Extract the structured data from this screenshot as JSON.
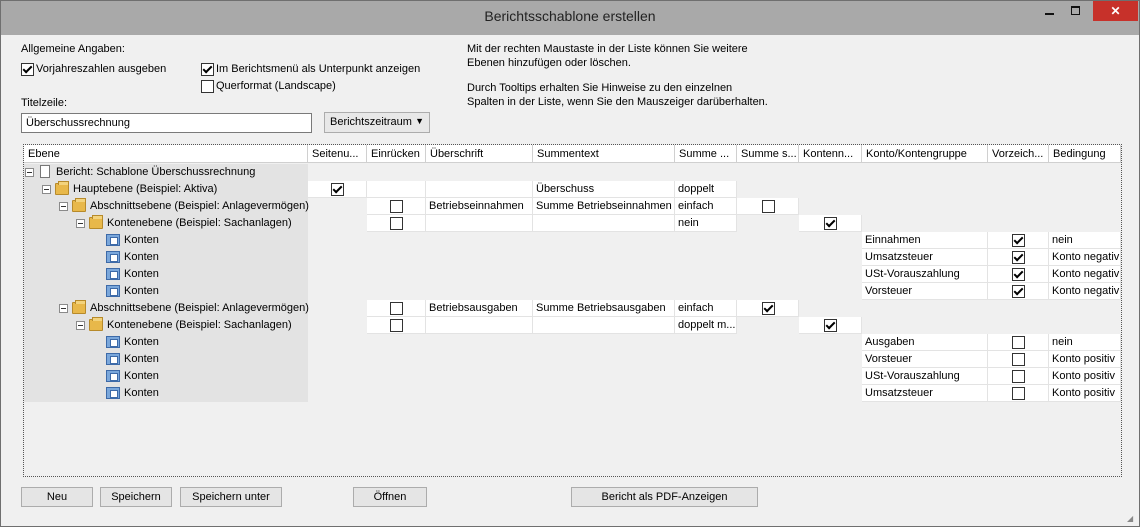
{
  "window": {
    "title": "Berichtsschablone erstellen"
  },
  "general": {
    "heading": "Allgemeine Angaben:",
    "prev_year": {
      "label": "Vorjahreszahlen ausgeben",
      "checked": true
    },
    "submenu": {
      "label": "Im Berichtsmenü als Unterpunkt anzeigen",
      "checked": true
    },
    "landscape": {
      "label": "Querformat (Landscape)",
      "checked": false
    },
    "title_label": "Titelzeile:",
    "title_value": "Überschussrechnung",
    "period_value": "Berichtszeitraum"
  },
  "hints": {
    "line1": "Mit der rechten Maustaste in der Liste können Sie weitere",
    "line2": "Ebenen hinzufügen oder löschen.",
    "line3": "Durch Tooltips erhalten Sie Hinweise zu den einzelnen",
    "line4": "Spalten in der Liste, wenn Sie den Mauszeiger darüberhalten."
  },
  "columns": [
    "Ebene",
    "Seitenu...",
    "Einrücken",
    "Überschrift",
    "Summentext",
    "Summe ...",
    "Summe s...",
    "Kontenn...",
    "Konto/Kontengruppe",
    "Vorzeich...",
    "Bedingung"
  ],
  "rows": [
    {
      "level": 0,
      "icon": "doc",
      "expand": true,
      "text": "Bericht: Schablone Überschussrechnung",
      "cells": {}
    },
    {
      "level": 1,
      "icon": "folder",
      "expand": true,
      "text": "Hauptebene (Beispiel: Aktiva)",
      "cells": {
        "seiten": true,
        "einr": null,
        "ueber": "",
        "summentext": "Überschuss",
        "summe": "doppelt"
      }
    },
    {
      "level": 2,
      "icon": "folder",
      "expand": true,
      "text": "Abschnittsebene (Beispiel: Anlagevermögen)",
      "cells": {
        "einr": false,
        "ueber": "Betriebseinnahmen",
        "summentext": "Summe Betriebseinnahmen",
        "summe": "einfach",
        "summes": false
      }
    },
    {
      "level": 3,
      "icon": "folder",
      "expand": true,
      "text": "Kontenebene (Beispiel: Sachanlagen)",
      "cells": {
        "einr": false,
        "ueber": "",
        "summentext": "",
        "summe": "nein",
        "konten": true
      }
    },
    {
      "level": 4,
      "icon": "acc",
      "expand": false,
      "text": "Konten",
      "cells": {
        "konto": "Einnahmen",
        "vorz": true,
        "bed": "nein"
      }
    },
    {
      "level": 4,
      "icon": "acc",
      "expand": false,
      "text": "Konten",
      "cells": {
        "konto": "Umsatzsteuer",
        "vorz": true,
        "bed": "Konto negativ"
      }
    },
    {
      "level": 4,
      "icon": "acc",
      "expand": false,
      "text": "Konten",
      "cells": {
        "konto": "USt-Vorauszahlung",
        "vorz": true,
        "bed": "Konto negativ"
      }
    },
    {
      "level": 4,
      "icon": "acc",
      "expand": false,
      "text": "Konten",
      "cells": {
        "konto": "Vorsteuer",
        "vorz": true,
        "bed": "Konto negativ"
      }
    },
    {
      "level": 2,
      "icon": "folder",
      "expand": true,
      "text": "Abschnittsebene (Beispiel: Anlagevermögen)",
      "cells": {
        "einr": false,
        "ueber": "Betriebsausgaben",
        "summentext": "Summe Betriebsausgaben",
        "summe": "einfach",
        "summes": true
      }
    },
    {
      "level": 3,
      "icon": "folder",
      "expand": true,
      "text": "Kontenebene (Beispiel: Sachanlagen)",
      "cells": {
        "einr": false,
        "ueber": "",
        "summentext": "",
        "summe": "doppelt m...",
        "konten": true
      }
    },
    {
      "level": 4,
      "icon": "acc",
      "expand": false,
      "text": "Konten",
      "cells": {
        "konto": "Ausgaben",
        "vorz": false,
        "bed": "nein"
      }
    },
    {
      "level": 4,
      "icon": "acc",
      "expand": false,
      "text": "Konten",
      "cells": {
        "konto": "Vorsteuer",
        "vorz": false,
        "bed": "Konto positiv"
      }
    },
    {
      "level": 4,
      "icon": "acc",
      "expand": false,
      "text": "Konten",
      "cells": {
        "konto": "USt-Vorauszahlung",
        "vorz": false,
        "bed": "Konto positiv"
      }
    },
    {
      "level": 4,
      "icon": "acc",
      "expand": false,
      "text": "Konten",
      "cells": {
        "konto": "Umsatzsteuer",
        "vorz": false,
        "bed": "Konto positiv"
      }
    }
  ],
  "buttons": {
    "new": "Neu",
    "save": "Speichern",
    "save_as": "Speichern unter",
    "open": "Öffnen",
    "pdf": "Bericht als PDF-Anzeigen"
  }
}
